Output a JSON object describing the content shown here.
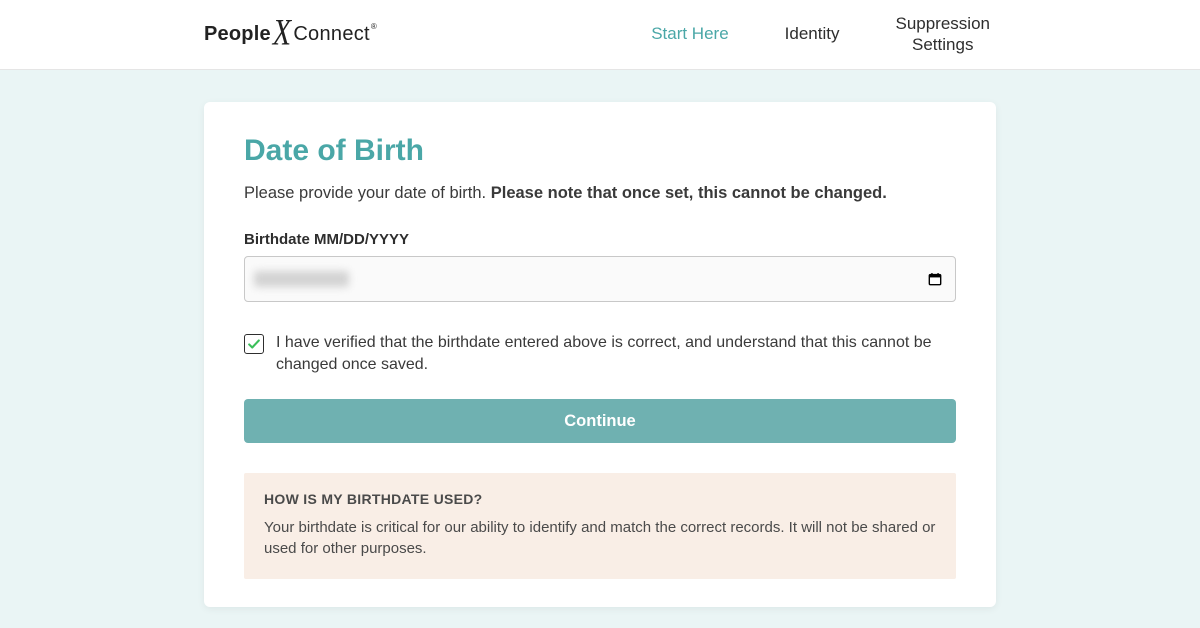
{
  "header": {
    "logo": {
      "part1": "People",
      "separator": "X",
      "part2": "Connect",
      "tm": "®"
    },
    "nav": [
      {
        "label": "Start Here",
        "active": true
      },
      {
        "label": "Identity",
        "active": false
      },
      {
        "label": "Suppression\nSettings",
        "active": false
      }
    ]
  },
  "card": {
    "title": "Date of Birth",
    "instruction_prefix": "Please provide your date of birth. ",
    "instruction_strong": "Please note that once set, this cannot be changed.",
    "field_label": "Birthdate MM/DD/YYYY",
    "date_value": "",
    "verify_checked": true,
    "verify_text": "I have verified that the birthdate entered above is correct, and understand that this cannot be changed once saved.",
    "continue_label": "Continue",
    "info_title": "HOW IS MY BIRTHDATE USED?",
    "info_text": "Your birthdate is critical for our ability to identify and match the correct records. It will not be shared or used for other purposes."
  }
}
